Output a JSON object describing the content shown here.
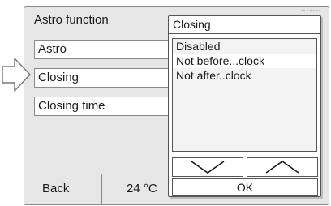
{
  "window": {
    "title": "Astro function"
  },
  "menu": {
    "items": [
      {
        "label": "Astro"
      },
      {
        "label": "Closing"
      },
      {
        "label": "Closing time"
      }
    ]
  },
  "footer": {
    "back_label": "Back",
    "temperature": "24 °C"
  },
  "popup": {
    "title": "Closing",
    "options": [
      {
        "label": "Disabled",
        "selected": false
      },
      {
        "label": "Not before...clock",
        "selected": true
      },
      {
        "label": "Not after..clock",
        "selected": false
      }
    ],
    "down_icon": "chevron-down-icon",
    "up_icon": "chevron-up-icon",
    "ok_label": "OK"
  }
}
